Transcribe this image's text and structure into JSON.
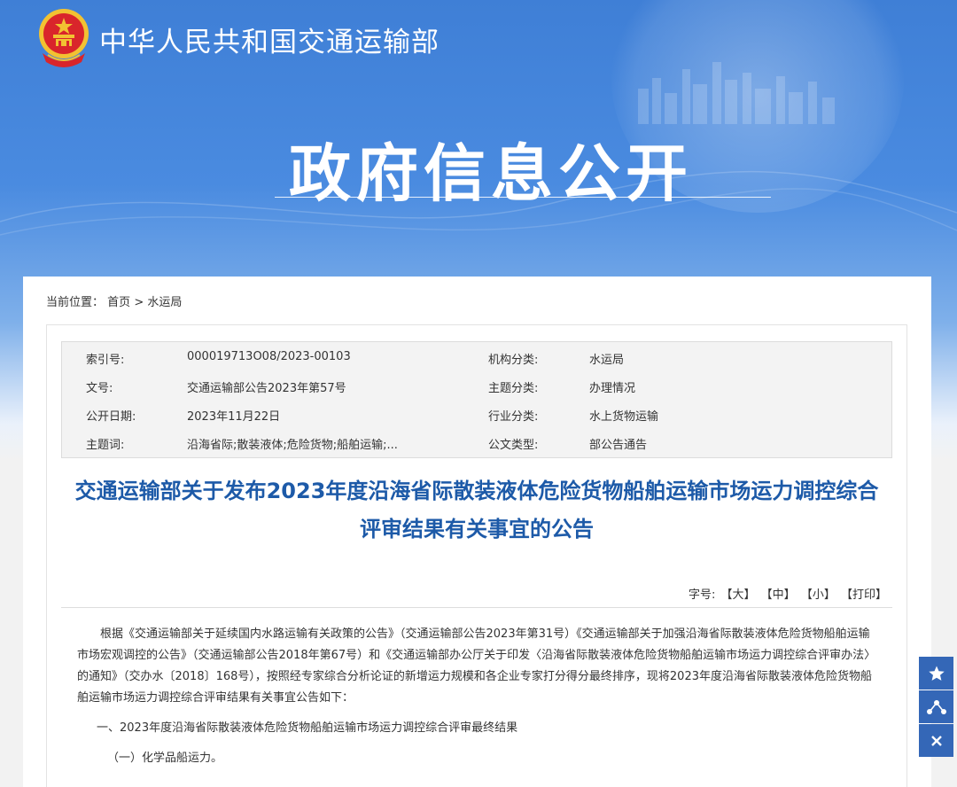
{
  "header": {
    "ministry_name": "中华人民共和国交通运输部",
    "section_title": "政府信息公开"
  },
  "breadcrumb": {
    "prefix": "当前位置：",
    "home": "首页",
    "separator": ">",
    "current": "水运局"
  },
  "meta": {
    "index_label": "索引号:",
    "index_value": "000019713O08/2023-00103",
    "org_label": "机构分类:",
    "org_value": "水运局",
    "docno_label": "文号:",
    "docno_value": "交通运输部公告2023年第57号",
    "topic_label": "主题分类:",
    "topic_value": "办理情况",
    "date_label": "公开日期:",
    "date_value": "2023年11月22日",
    "industry_label": "行业分类:",
    "industry_value": "水上货物运输",
    "keywords_label": "主题词:",
    "keywords_value": "沿海省际;散装液体;危险货物;船舶运输;...",
    "doctype_label": "公文类型:",
    "doctype_value": "部公告通告"
  },
  "document": {
    "title": "交通运输部关于发布2023年度沿海省际散装液体危险货物船舶运输市场运力调控综合评审结果有关事宜的公告",
    "font_size_label": "字号:",
    "font_large": "【大】",
    "font_medium": "【中】",
    "font_small": "【小】",
    "print": "【打印】",
    "paragraph1": "根据《交通运输部关于延续国内水路运输有关政策的公告》（交通运输部公告2023年第31号）《交通运输部关于加强沿海省际散装液体危险货物船舶运输市场宏观调控的公告》（交通运输部公告2018年第67号）和《交通运输部办公厅关于印发〈沿海省际散装液体危险货物船舶运输市场运力调控综合评审办法〉的通知》（交办水〔2018〕168号），按照经专家综合分析论证的新增运力规模和各企业专家打分得分最终排序，现将2023年度沿海省际散装液体危险货物船舶运输市场运力调控综合评审结果有关事宜公告如下：",
    "paragraph2": "一、2023年度沿海省际散装液体危险货物船舶运输市场运力调控综合评审最终结果",
    "paragraph3": "（一）化学品船运力。"
  },
  "float_buttons": {
    "favorite_icon": "star-icon",
    "share_icon": "share-icon",
    "close_icon": "close-icon"
  },
  "colors": {
    "banner_blue": "#3f7fd6",
    "title_blue": "#1d5aa8",
    "button_blue": "#3467b7"
  }
}
